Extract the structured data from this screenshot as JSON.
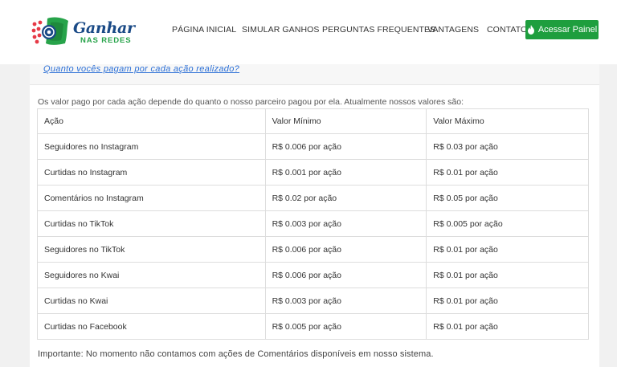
{
  "brand": {
    "name": "Ganhar",
    "tagline": "NAS REDES"
  },
  "nav": {
    "items": [
      {
        "label": "PÁGINA INICIAL"
      },
      {
        "label": "SIMULAR GANHOS"
      },
      {
        "label": "PERGUNTAS FREQUENTES"
      },
      {
        "label": "VANTAGENS"
      },
      {
        "label": "CONTATO"
      }
    ],
    "cta_label": "Acessar Painel",
    "cta_icon": "fire-icon"
  },
  "colors": {
    "accent": "#1e9e3e",
    "link": "#2b6fd6",
    "brand_blue": "#1a4a86",
    "brand_green": "#27a34a"
  },
  "faq": {
    "question": "Quanto vocês pagam por cada ação realizado?",
    "answer_intro": "Os valor pago por cada ação depende do quanto o nosso parceiro pagou por ela. Atualmente nossos valores são:"
  },
  "table": {
    "headers": [
      "Ação",
      "Valor Mínimo",
      "Valor Máximo"
    ],
    "rows": [
      [
        "Seguidores no Instagram",
        "R$ 0.006 por ação",
        "R$ 0.03 por ação"
      ],
      [
        "Curtidas no Instagram",
        "R$ 0.001 por ação",
        "R$ 0.01 por ação"
      ],
      [
        "Comentários no Instagram",
        "R$ 0.02 por ação",
        "R$ 0.05 por ação"
      ],
      [
        "Curtidas no TikTok",
        "R$ 0.003 por ação",
        "R$ 0.005 por ação"
      ],
      [
        "Seguidores no TikTok",
        "R$ 0.006 por ação",
        "R$ 0.01 por ação"
      ],
      [
        "Seguidores no Kwai",
        "R$ 0.006 por ação",
        "R$ 0.01 por ação"
      ],
      [
        "Curtidas no Kwai",
        "R$ 0.003 por ação",
        "R$ 0.01 por ação"
      ],
      [
        "Curtidas no Facebook",
        "R$ 0.005 por ação",
        "R$ 0.01 por ação"
      ]
    ]
  },
  "note": "Importante: No momento não contamos com ações de Comentários disponíveis em nosso sistema."
}
